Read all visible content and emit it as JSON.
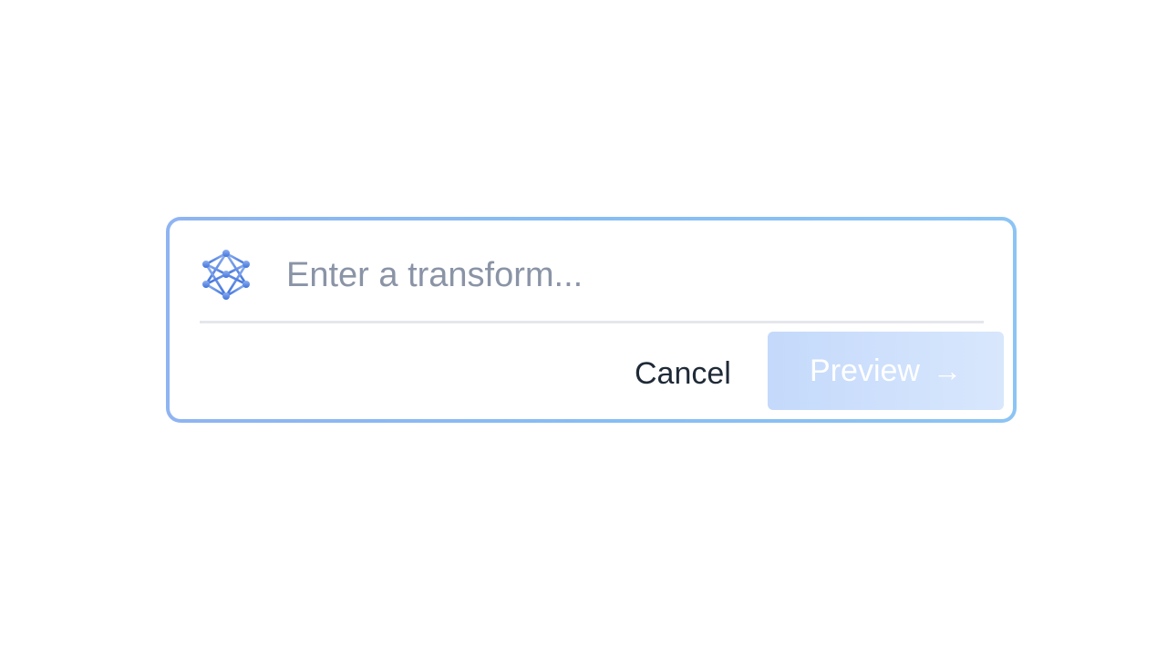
{
  "prompt_bar": {
    "input": {
      "value": "",
      "placeholder": "Enter a transform..."
    },
    "cancel_label": "Cancel",
    "preview_label": "Preview",
    "preview_icon": "arrow-right-icon",
    "logo_icon": "network-icon",
    "preview_enabled": false
  },
  "colors": {
    "border_gradient_start": "#8fb4f2",
    "border_gradient_end": "#8cc4f4",
    "icon_blue": "#4a7fe0",
    "preview_bg_start": "#c4d9fb",
    "preview_bg_end": "#d8e7fc",
    "placeholder": "#8a94a6",
    "cancel_text": "#1f2a37"
  }
}
